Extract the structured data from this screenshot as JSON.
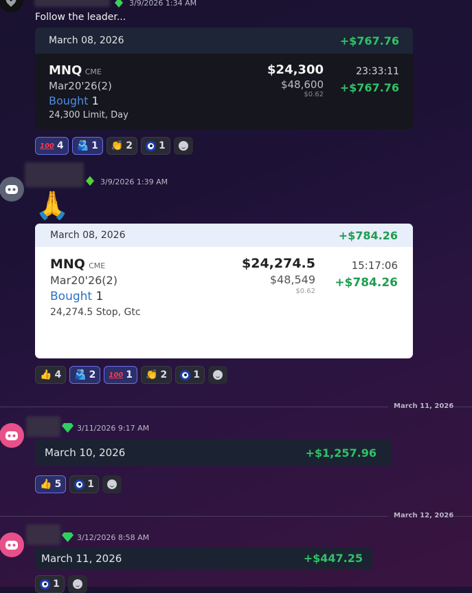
{
  "messages": [
    {
      "timestamp": "3/9/2026 1:34 AM",
      "text": "Follow the leader...",
      "card": {
        "date": "March 08, 2026",
        "header_pnl": "+$767.76",
        "symbol": "MNQ",
        "exchange": "CME",
        "contract": "Mar20'26(2)",
        "side": "Bought",
        "qty": "1",
        "order": "24,300 Limit, Day",
        "price": "$24,300",
        "notional": "$48,600",
        "fee": "$0.62",
        "time": "23:33:11",
        "pnl": "+$767.76"
      },
      "reactions": [
        {
          "icon": "hundred-points-icon",
          "count": "4",
          "selected": true
        },
        {
          "icon": "people-hugging-icon",
          "count": "1",
          "selected": true
        },
        {
          "icon": "clapping-hands-icon",
          "count": "2",
          "selected": false
        },
        {
          "icon": "nazar-amulet-icon",
          "count": "1",
          "selected": false
        }
      ]
    },
    {
      "timestamp": "3/9/2026 1:39 AM",
      "emoji": "🙏",
      "card": {
        "date": "March 08, 2026",
        "header_pnl": "+$784.26",
        "symbol": "MNQ",
        "exchange": "CME",
        "contract": "Mar20'26(2)",
        "side": "Bought",
        "qty": "1",
        "order": "24,274.5 Stop, Gtc",
        "price": "$24,274.5",
        "notional": "$48,549",
        "fee": "$0.62",
        "time": "15:17:06",
        "pnl": "+$784.26"
      },
      "reactions": [
        {
          "icon": "thumbs-up-icon",
          "count": "4",
          "selected": false
        },
        {
          "icon": "people-hugging-icon",
          "count": "2",
          "selected": true
        },
        {
          "icon": "hundred-points-icon",
          "count": "1",
          "selected": true
        },
        {
          "icon": "clapping-hands-icon",
          "count": "2",
          "selected": false
        },
        {
          "icon": "nazar-amulet-icon",
          "count": "1",
          "selected": false
        }
      ]
    },
    {
      "divider": "March 11, 2026",
      "timestamp": "3/11/2026 9:17 AM",
      "card": {
        "date": "March 10, 2026",
        "header_pnl": "+$1,257.96"
      },
      "reactions": [
        {
          "icon": "thumbs-up-icon",
          "count": "5",
          "selected": true
        },
        {
          "icon": "nazar-amulet-icon",
          "count": "1",
          "selected": false
        }
      ]
    },
    {
      "divider": "March 12, 2026",
      "timestamp": "3/12/2026 8:58 AM",
      "card": {
        "date": "March 11, 2026",
        "header_pnl": "+$447.25"
      },
      "reactions": [
        {
          "icon": "nazar-amulet-icon",
          "count": "1",
          "selected": false
        }
      ]
    }
  ]
}
